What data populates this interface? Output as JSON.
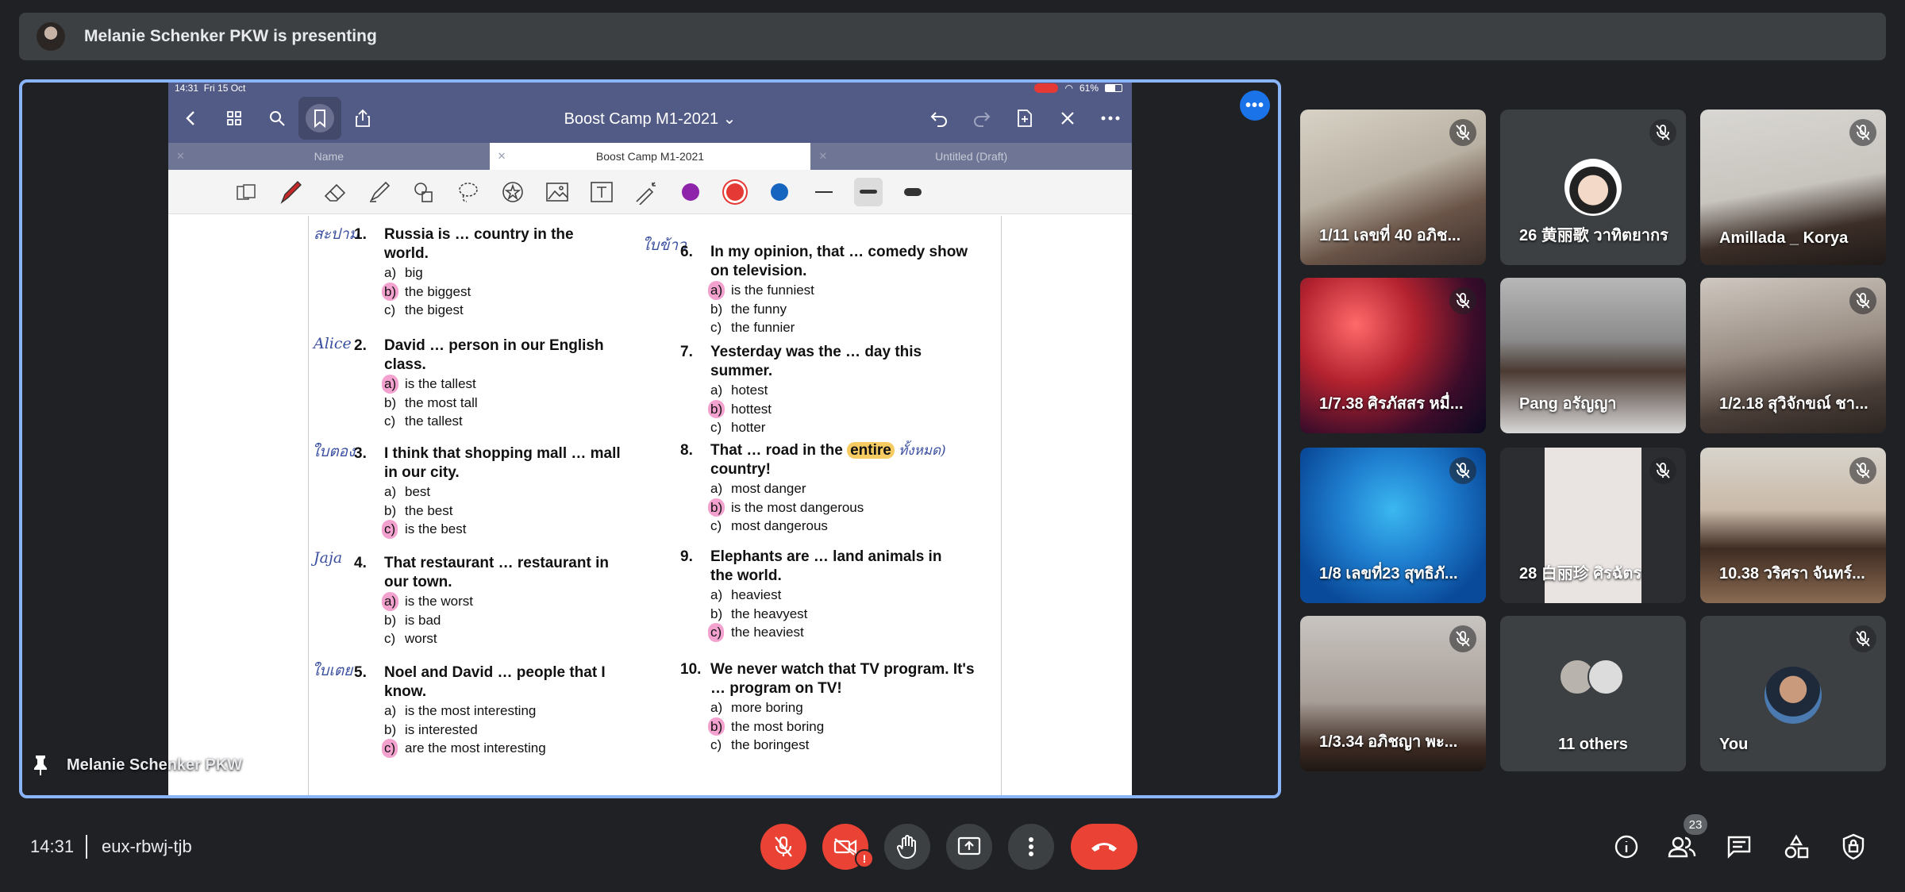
{
  "top_bar": {
    "presenting_text": "Melanie Schenker PKW is presenting"
  },
  "presentation": {
    "presenter_label": "Melanie Schenker PKW",
    "ipad": {
      "status_time": "14:31",
      "status_date": "Fri 15 Oct",
      "battery": "61%",
      "document_title": "Boost Camp M1-2021",
      "tabs": [
        {
          "label": "Name",
          "active": false
        },
        {
          "label": "Boost Camp M1-2021",
          "active": true
        },
        {
          "label": "Untitled (Draft)",
          "active": false
        }
      ],
      "colors": {
        "purple": "#8e24aa",
        "red": "#e53935",
        "blue": "#1565c0"
      }
    },
    "worksheet": {
      "handwritten": [
        "สะปาม",
        "Alice",
        "ใบตอง",
        "Jaja",
        "ใบเตย",
        "ใบข้าว",
        "ทั้งหมด)"
      ],
      "questions": [
        {
          "num": "1.",
          "stem": [
            "Russia is … country in the",
            "world."
          ],
          "options": [
            {
              "l": "a)",
              "t": "big"
            },
            {
              "l": "b)",
              "t": "the biggest",
              "sel": true
            },
            {
              "l": "c)",
              "t": "the bigest"
            }
          ]
        },
        {
          "num": "2.",
          "stem": [
            "David … person in our English",
            "class."
          ],
          "options": [
            {
              "l": "a)",
              "t": "is the tallest",
              "sel": true
            },
            {
              "l": "b)",
              "t": "the most tall"
            },
            {
              "l": "c)",
              "t": "the tallest"
            }
          ]
        },
        {
          "num": "3.",
          "stem": [
            "I think that shopping mall … mall",
            "in our city."
          ],
          "options": [
            {
              "l": "a)",
              "t": "best"
            },
            {
              "l": "b)",
              "t": "the best"
            },
            {
              "l": "c)",
              "t": "is the best",
              "sel": true
            }
          ]
        },
        {
          "num": "4.",
          "stem": [
            "That restaurant … restaurant in",
            "our town."
          ],
          "options": [
            {
              "l": "a)",
              "t": "is the worst",
              "sel": true
            },
            {
              "l": "b)",
              "t": "is bad"
            },
            {
              "l": "c)",
              "t": "worst"
            }
          ]
        },
        {
          "num": "5.",
          "stem": [
            "Noel and David … people that I",
            "know."
          ],
          "options": [
            {
              "l": "a)",
              "t": "is the most interesting"
            },
            {
              "l": "b)",
              "t": "is interested"
            },
            {
              "l": "c)",
              "t": "are the most interesting",
              "sel": true
            }
          ]
        },
        {
          "num": "6.",
          "stem": [
            "In my opinion, that … comedy show",
            "on television."
          ],
          "options": [
            {
              "l": "a)",
              "t": "is the funniest",
              "sel": true
            },
            {
              "l": "b)",
              "t": "the funny"
            },
            {
              "l": "c)",
              "t": "the funnier"
            }
          ]
        },
        {
          "num": "7.",
          "stem": [
            "Yesterday was the … day this",
            "summer."
          ],
          "options": [
            {
              "l": "a)",
              "t": "hotest"
            },
            {
              "l": "b)",
              "t": "hottest",
              "sel": true
            },
            {
              "l": "c)",
              "t": "hotter"
            }
          ]
        },
        {
          "num": "8.",
          "stem_a": "That … road in the ",
          "stem_hl": "entire",
          "stem_b": "country!",
          "options": [
            {
              "l": "a)",
              "t": "most danger"
            },
            {
              "l": "b)",
              "t": "is the most dangerous",
              "sel": true
            },
            {
              "l": "c)",
              "t": "most dangerous"
            }
          ]
        },
        {
          "num": "9.",
          "stem": [
            "Elephants are … land animals in",
            "the world."
          ],
          "options": [
            {
              "l": "a)",
              "t": "heaviest"
            },
            {
              "l": "b)",
              "t": "the heavyest"
            },
            {
              "l": "c)",
              "t": "the heaviest",
              "sel": true
            }
          ]
        },
        {
          "num": "10.",
          "stem": [
            "We never watch that TV program.  It's",
            "… program on TV!"
          ],
          "options": [
            {
              "l": "a)",
              "t": "more boring"
            },
            {
              "l": "b)",
              "t": "the most boring",
              "sel": true
            },
            {
              "l": "c)",
              "t": "the boringest"
            }
          ]
        }
      ]
    }
  },
  "participants": [
    {
      "name": "1/11 เลขที่ 40 อภิช...",
      "muted": true
    },
    {
      "name": "26 黄丽歌 วาทิตยากร",
      "muted": true
    },
    {
      "name": "Amillada _ Korya",
      "muted": true
    },
    {
      "name": "1/7.38 ศิรภัสสร หมื่...",
      "muted": true
    },
    {
      "name": "Pang อรัญญา",
      "muted": false
    },
    {
      "name": "1/2.18 สุวิจักขณ์ ชา...",
      "muted": true
    },
    {
      "name": "1/8 เลขที่23 สุทธิภั...",
      "muted": true
    },
    {
      "name": "28 白丽珍 ศิรฉัตร",
      "muted": true
    },
    {
      "name": "10.38 วริศรา จันทร์...",
      "muted": true
    },
    {
      "name": "1/3.34 อภิชญา พะ...",
      "muted": true
    },
    {
      "name": "11 others",
      "muted": false
    },
    {
      "name": "You",
      "muted": true
    }
  ],
  "bottom_bar": {
    "time": "14:31",
    "meeting_code": "eux-rbwj-tjb",
    "people_count": "23",
    "camera_alert": "!"
  }
}
